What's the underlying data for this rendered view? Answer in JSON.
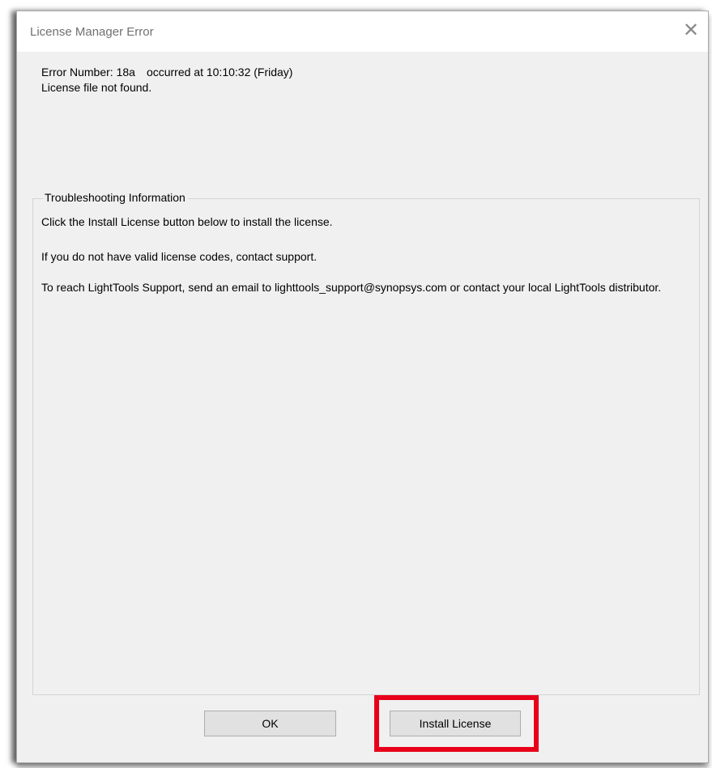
{
  "dialog": {
    "title": "License Manager Error",
    "close_symbol": "✕",
    "error": {
      "number_label": "Error Number: 18a",
      "occurred": "occurred at 10:10:32 (Friday)",
      "message": "License file not found."
    },
    "troubleshooting": {
      "heading": "Troubleshooting Information",
      "line1": "Click the Install License button below to install the license.",
      "line2": "If you do not have valid license codes, contact support.",
      "line3": "To reach LightTools Support, send an email to lighttools_support@synopsys.com or contact your local LightTools distributor."
    },
    "buttons": {
      "ok": "OK",
      "install": "Install License"
    }
  },
  "colors": {
    "highlight": "#e8001a",
    "dialog_background": "#f0f0f0",
    "button_background": "#e1e1e1"
  },
  "icons": {
    "close": "close-icon"
  }
}
